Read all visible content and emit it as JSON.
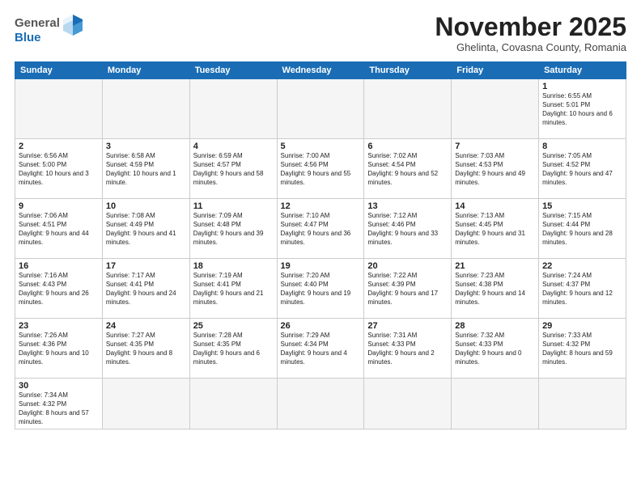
{
  "header": {
    "logo_general": "General",
    "logo_blue": "Blue",
    "month": "November 2025",
    "location": "Ghelinta, Covasna County, Romania"
  },
  "days_of_week": [
    "Sunday",
    "Monday",
    "Tuesday",
    "Wednesday",
    "Thursday",
    "Friday",
    "Saturday"
  ],
  "weeks": [
    [
      {
        "day": "",
        "info": ""
      },
      {
        "day": "",
        "info": ""
      },
      {
        "day": "",
        "info": ""
      },
      {
        "day": "",
        "info": ""
      },
      {
        "day": "",
        "info": ""
      },
      {
        "day": "",
        "info": ""
      },
      {
        "day": "1",
        "info": "Sunrise: 6:55 AM\nSunset: 5:01 PM\nDaylight: 10 hours and 6 minutes."
      }
    ],
    [
      {
        "day": "2",
        "info": "Sunrise: 6:56 AM\nSunset: 5:00 PM\nDaylight: 10 hours and 3 minutes."
      },
      {
        "day": "3",
        "info": "Sunrise: 6:58 AM\nSunset: 4:59 PM\nDaylight: 10 hours and 1 minute."
      },
      {
        "day": "4",
        "info": "Sunrise: 6:59 AM\nSunset: 4:57 PM\nDaylight: 9 hours and 58 minutes."
      },
      {
        "day": "5",
        "info": "Sunrise: 7:00 AM\nSunset: 4:56 PM\nDaylight: 9 hours and 55 minutes."
      },
      {
        "day": "6",
        "info": "Sunrise: 7:02 AM\nSunset: 4:54 PM\nDaylight: 9 hours and 52 minutes."
      },
      {
        "day": "7",
        "info": "Sunrise: 7:03 AM\nSunset: 4:53 PM\nDaylight: 9 hours and 49 minutes."
      },
      {
        "day": "8",
        "info": "Sunrise: 7:05 AM\nSunset: 4:52 PM\nDaylight: 9 hours and 47 minutes."
      }
    ],
    [
      {
        "day": "9",
        "info": "Sunrise: 7:06 AM\nSunset: 4:51 PM\nDaylight: 9 hours and 44 minutes."
      },
      {
        "day": "10",
        "info": "Sunrise: 7:08 AM\nSunset: 4:49 PM\nDaylight: 9 hours and 41 minutes."
      },
      {
        "day": "11",
        "info": "Sunrise: 7:09 AM\nSunset: 4:48 PM\nDaylight: 9 hours and 39 minutes."
      },
      {
        "day": "12",
        "info": "Sunrise: 7:10 AM\nSunset: 4:47 PM\nDaylight: 9 hours and 36 minutes."
      },
      {
        "day": "13",
        "info": "Sunrise: 7:12 AM\nSunset: 4:46 PM\nDaylight: 9 hours and 33 minutes."
      },
      {
        "day": "14",
        "info": "Sunrise: 7:13 AM\nSunset: 4:45 PM\nDaylight: 9 hours and 31 minutes."
      },
      {
        "day": "15",
        "info": "Sunrise: 7:15 AM\nSunset: 4:44 PM\nDaylight: 9 hours and 28 minutes."
      }
    ],
    [
      {
        "day": "16",
        "info": "Sunrise: 7:16 AM\nSunset: 4:43 PM\nDaylight: 9 hours and 26 minutes."
      },
      {
        "day": "17",
        "info": "Sunrise: 7:17 AM\nSunset: 4:41 PM\nDaylight: 9 hours and 24 minutes."
      },
      {
        "day": "18",
        "info": "Sunrise: 7:19 AM\nSunset: 4:41 PM\nDaylight: 9 hours and 21 minutes."
      },
      {
        "day": "19",
        "info": "Sunrise: 7:20 AM\nSunset: 4:40 PM\nDaylight: 9 hours and 19 minutes."
      },
      {
        "day": "20",
        "info": "Sunrise: 7:22 AM\nSunset: 4:39 PM\nDaylight: 9 hours and 17 minutes."
      },
      {
        "day": "21",
        "info": "Sunrise: 7:23 AM\nSunset: 4:38 PM\nDaylight: 9 hours and 14 minutes."
      },
      {
        "day": "22",
        "info": "Sunrise: 7:24 AM\nSunset: 4:37 PM\nDaylight: 9 hours and 12 minutes."
      }
    ],
    [
      {
        "day": "23",
        "info": "Sunrise: 7:26 AM\nSunset: 4:36 PM\nDaylight: 9 hours and 10 minutes."
      },
      {
        "day": "24",
        "info": "Sunrise: 7:27 AM\nSunset: 4:35 PM\nDaylight: 9 hours and 8 minutes."
      },
      {
        "day": "25",
        "info": "Sunrise: 7:28 AM\nSunset: 4:35 PM\nDaylight: 9 hours and 6 minutes."
      },
      {
        "day": "26",
        "info": "Sunrise: 7:29 AM\nSunset: 4:34 PM\nDaylight: 9 hours and 4 minutes."
      },
      {
        "day": "27",
        "info": "Sunrise: 7:31 AM\nSunset: 4:33 PM\nDaylight: 9 hours and 2 minutes."
      },
      {
        "day": "28",
        "info": "Sunrise: 7:32 AM\nSunset: 4:33 PM\nDaylight: 9 hours and 0 minutes."
      },
      {
        "day": "29",
        "info": "Sunrise: 7:33 AM\nSunset: 4:32 PM\nDaylight: 8 hours and 59 minutes."
      }
    ],
    [
      {
        "day": "30",
        "info": "Sunrise: 7:34 AM\nSunset: 4:32 PM\nDaylight: 8 hours and 57 minutes."
      },
      {
        "day": "",
        "info": ""
      },
      {
        "day": "",
        "info": ""
      },
      {
        "day": "",
        "info": ""
      },
      {
        "day": "",
        "info": ""
      },
      {
        "day": "",
        "info": ""
      },
      {
        "day": "",
        "info": ""
      }
    ]
  ]
}
